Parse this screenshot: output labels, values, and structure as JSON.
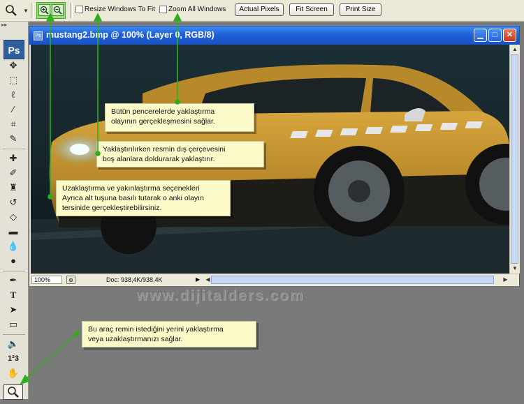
{
  "options_bar": {
    "zoom_in_label": "+",
    "zoom_out_label": "-",
    "resize_windows_label": "Resize Windows To Fit",
    "zoom_all_label": "Zoom All Windows",
    "actual_pixels_label": "Actual Pixels",
    "fit_screen_label": "Fit Screen",
    "print_size_label": "Print Size"
  },
  "toolbox": {
    "logo": "Ps",
    "tools": [
      "move-tool",
      "marquee-tool",
      "lasso-tool",
      "magic-wand-tool",
      "crop-tool",
      "slice-tool",
      "healing-brush-tool",
      "brush-tool",
      "clone-stamp-tool",
      "history-brush-tool",
      "eraser-tool",
      "gradient-tool",
      "blur-tool",
      "dodge-tool",
      "pen-tool",
      "type-tool",
      "path-selection-tool",
      "shape-tool",
      "notes-tool",
      "eyedropper-tool",
      "hand-tool",
      "zoom-tool"
    ],
    "type_tool_label": "T",
    "count_tool_label": "1²3"
  },
  "document": {
    "title": "mustang2.bmp @ 100% (Layer 0, RGB/8)",
    "zoom_percent": "100%",
    "doc_size": "Doc: 938,4K/938,4K"
  },
  "watermark": "www.dijitalders.com",
  "callouts": {
    "zoom_all": [
      "Bütün pencerelerde yaklaştırma",
      "olayının gerçekleşmesini sağlar."
    ],
    "resize_windows": [
      "Yaklaştırılırken resmin dış çerçevesini",
      "boş alanlara doldurarak yaklaştırır."
    ],
    "zoom_modes": [
      "Uzaklaştırma ve yakınlaştırma seçenekleri",
      "Ayrıca alt tuşuna basılı tutarak o anki olayın",
      "tersinide gerçekleştirebilirsiniz."
    ],
    "zoom_tool": [
      "Bu araç remin istediğini yerini yaklaştırma",
      "veya uzaklaştırmanızı sağlar."
    ]
  },
  "colors": {
    "accent_green": "#2fae1a",
    "title_bar_blue": "#1f5fd6",
    "callout_bg": "#fdfac9",
    "car_body": "#b8892b"
  }
}
